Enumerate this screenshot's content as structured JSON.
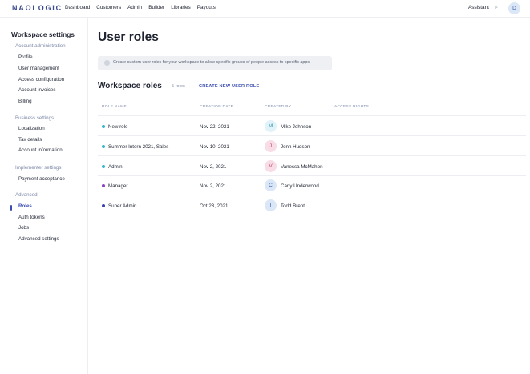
{
  "brand": {
    "logo": "NAOLOGIC"
  },
  "nav": {
    "items": [
      "Dashboard",
      "Customers",
      "Admin",
      "Builder",
      "Libraries",
      "Payouts"
    ],
    "assistant": "Assistant",
    "toggle_glyph": "⫸",
    "user_initial": "D"
  },
  "sidebar": {
    "title": "Workspace settings",
    "groups": [
      {
        "label": "Account administration",
        "items": [
          "Profile",
          "User management",
          "Access configuration",
          "Account invoices",
          "Billing"
        ]
      },
      {
        "label": "Business settings",
        "items": [
          "Localization",
          "Tax details",
          "Account information"
        ]
      },
      {
        "label": "Implementer settings",
        "items": [
          "Payment acceptance"
        ]
      },
      {
        "label": "Advanced",
        "items": [
          "Roles",
          "Auth tokens",
          "Jobs",
          "Advanced settings"
        ]
      }
    ],
    "active_item": "Roles"
  },
  "page": {
    "title": "User roles",
    "info": "Create custom user roles for your workspace to allow specific groups of people access to specific apps",
    "section_title": "Workspace roles",
    "section_count": "5 roles",
    "create_button": "CREATE NEW USER ROLE"
  },
  "table": {
    "headers": [
      "ROLE NAME",
      "CREATION DATE",
      "CREATED BY",
      "ACCESS RIGHTS"
    ],
    "rows": [
      {
        "name": "New role",
        "date": "Nov 22, 2021",
        "creator": "Mike Johnson",
        "initial": "M",
        "dot_color": "#36b3c9",
        "avatar_bg": "#dff3f8",
        "avatar_fg": "#2f8fa8"
      },
      {
        "name": "Summer Intern 2021, Sales",
        "date": "Nov 10, 2021",
        "creator": "Jenn Hudson",
        "initial": "J",
        "dot_color": "#36b3c9",
        "avatar_bg": "#f8dce6",
        "avatar_fg": "#b8476f"
      },
      {
        "name": "Admin",
        "date": "Nov 2, 2021",
        "creator": "Vanessa McMahon",
        "initial": "V",
        "dot_color": "#36b3c9",
        "avatar_bg": "#f8dce6",
        "avatar_fg": "#b8476f"
      },
      {
        "name": "Manager",
        "date": "Nov 2, 2021",
        "creator": "Carly Underwood",
        "initial": "C",
        "dot_color": "#8a3fc4",
        "avatar_bg": "#dbe7f7",
        "avatar_fg": "#3a5fa8"
      },
      {
        "name": "Super Admin",
        "date": "Oct 23, 2021",
        "creator": "Todd Brent",
        "initial": "T",
        "dot_color": "#3b3fb0",
        "avatar_bg": "#dbe7f7",
        "avatar_fg": "#3a5fa8"
      }
    ]
  },
  "colors": {
    "accent": "#3b4eaf",
    "muted": "#7c8aa8",
    "info_bg": "#eef0f4"
  }
}
